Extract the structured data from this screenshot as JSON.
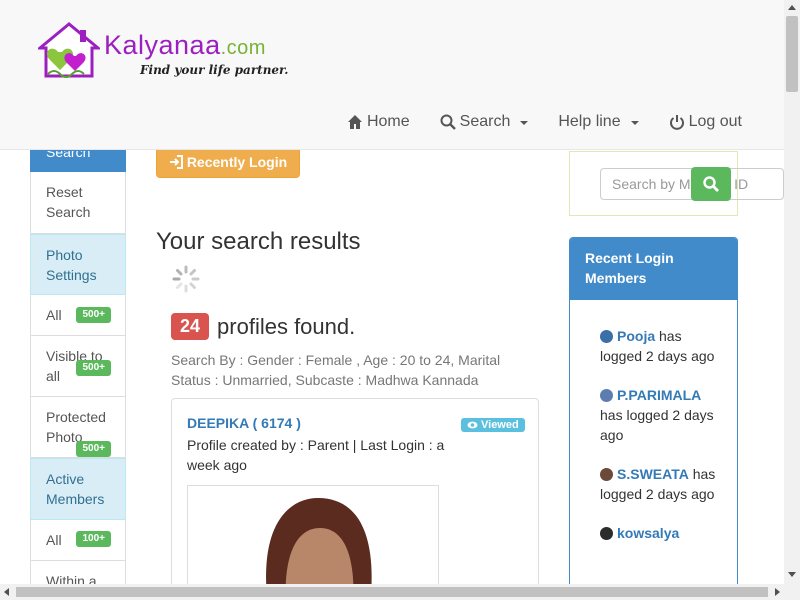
{
  "brand": {
    "name": "Kalyanaa",
    "suffix": ".com",
    "tagline": "Find your life partner."
  },
  "nav": {
    "home": "Home",
    "search": "Search",
    "helpline": "Help line",
    "logout": "Log out"
  },
  "sidebar": {
    "top_label": "Search",
    "reset": "Reset Search",
    "photo_settings": "Photo Settings",
    "photo_items": [
      {
        "label": "All",
        "badge": "500+"
      },
      {
        "label": "Visible to all",
        "badge": "500+"
      },
      {
        "label": "Protected Photo",
        "badge": "500+"
      }
    ],
    "active_members": "Active Members",
    "active_items": [
      {
        "label": "All",
        "badge": "100+"
      },
      {
        "label": "Within a",
        "badge": ""
      }
    ]
  },
  "main": {
    "recent_login_button": "Recently Login",
    "results_title": "Your search results",
    "count": "24",
    "found_text": "profiles found.",
    "criteria": "Search By : Gender : Female , Age : 20 to 24, Marital Status : Unmarried, Subcaste : Madhwa Kannada",
    "profile": {
      "name": "DEEPIKA ( 6174 )",
      "viewed": "Viewed",
      "meta": "Profile created by : Parent | Last Login : a week ago"
    }
  },
  "right": {
    "search_placeholder": "Search by Member ID",
    "recent_title": "Recent Login Members",
    "members": [
      {
        "name": "Pooja",
        "text": "has logged 2 days ago"
      },
      {
        "name": "P.PARIMALA",
        "text": "has logged 2 days ago"
      },
      {
        "name": "S.SWEATA",
        "text": "has logged 2 days ago"
      },
      {
        "name": "kowsalya",
        "text": ""
      }
    ]
  },
  "colors": {
    "brand_purple": "#9c1fbf",
    "primary": "#428bca",
    "warning": "#f0ad4e",
    "success": "#5cb85c",
    "danger": "#d9534f",
    "info": "#5bc0de"
  }
}
